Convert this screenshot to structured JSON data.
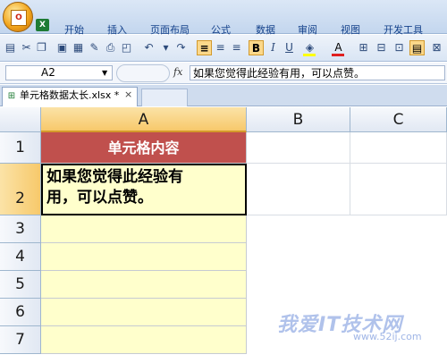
{
  "ribbon": {
    "tabs": [
      "开始",
      "插入",
      "页面布局",
      "公式",
      "数据",
      "审阅",
      "视图",
      "开发工具"
    ]
  },
  "toolbar": {
    "bold": "B",
    "italic": "I",
    "underline": "U",
    "font_color_letter": "A"
  },
  "formula_bar": {
    "name_box": "A2",
    "fx": "fx",
    "content": "如果您觉得此经验有用，可以点赞。"
  },
  "document": {
    "tab_label": "单元格数据太长.xlsx *",
    "close": "×"
  },
  "sheet": {
    "columns": [
      "A",
      "B",
      "C"
    ],
    "selected_column": "A",
    "rows": [
      "1",
      "2",
      "3",
      "4",
      "5",
      "6",
      "7"
    ],
    "selected_row": "2",
    "cells": {
      "A1": "单元格内容",
      "A2_line1": "如果您觉得此经验有",
      "A2_line2": "用，可以点赞。"
    },
    "colors": {
      "header_fill": "#c0504d",
      "cell_fill": "#ffffcc",
      "selection_header": "#f7c96b"
    }
  },
  "watermark": {
    "text": "我爱IT技术网",
    "sub": "www.52ij.com"
  }
}
